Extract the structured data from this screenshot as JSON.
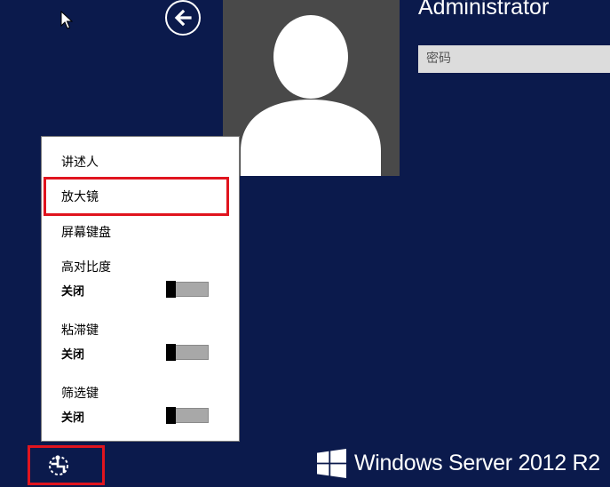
{
  "user": {
    "name": "Administrator",
    "password_placeholder": "密码"
  },
  "ease_menu": {
    "items": [
      {
        "label": "讲述人"
      },
      {
        "label": "放大镜"
      },
      {
        "label": "屏幕键盘"
      }
    ],
    "toggles": [
      {
        "label": "高对比度",
        "state": "关闭"
      },
      {
        "label": "粘滞键",
        "state": "关闭"
      },
      {
        "label": "筛选键",
        "state": "关闭"
      }
    ]
  },
  "brand": {
    "text": "Windows Server 2012 R2"
  },
  "colors": {
    "background": "#0b1a4c",
    "highlight": "#e0141e",
    "avatar_bg": "#494949"
  },
  "icons": {
    "back": "back-arrow-icon",
    "ease": "ease-of-access-icon",
    "logo": "windows-logo-icon",
    "cursor": "mouse-pointer-icon"
  }
}
